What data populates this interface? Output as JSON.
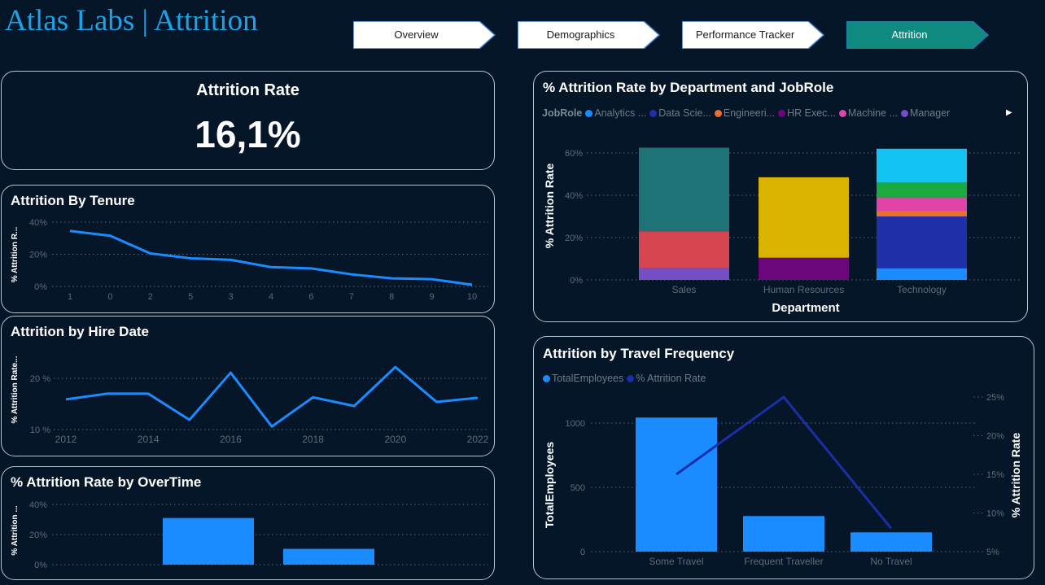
{
  "header": {
    "title": "Atlas Labs | Attrition"
  },
  "nav": [
    {
      "label": "Overview",
      "active": false
    },
    {
      "label": "Demographics",
      "active": false
    },
    {
      "label": "Performance Tracker",
      "active": false
    },
    {
      "label": "Attrition",
      "active": true
    }
  ],
  "colors": {
    "background": "#051629",
    "nav_active": "#0e8a7e",
    "nav_inactive": "#ffffff",
    "line_blue": "#1a8cff",
    "line_navy": "#1b2ea6",
    "gridline": "#5a6672",
    "axis_text": "#5f6b77"
  },
  "kpi": {
    "label": "Attrition Rate",
    "value": "16,1%"
  },
  "chart_data": [
    {
      "id": "tenure",
      "type": "line",
      "title": "Attrition By Tenure",
      "ylabel": "% Attrition R...",
      "xlabel": "",
      "categories": [
        "1",
        "0",
        "2",
        "5",
        "3",
        "4",
        "6",
        "7",
        "8",
        "9",
        "10"
      ],
      "values": [
        34.5,
        31.5,
        20.5,
        17.5,
        16.5,
        12,
        11.2,
        7.5,
        5,
        4.5,
        1
      ],
      "yticks": [
        "40%",
        "20%",
        "0%"
      ],
      "ylim": [
        0,
        40
      ],
      "color": "#1a8cff",
      "grid": true
    },
    {
      "id": "hiredate",
      "type": "line",
      "title": "Attrition by Hire Date",
      "ylabel": "% Attrition Rate...",
      "xlabel": "",
      "x": [
        2012,
        2013,
        2014,
        2015,
        2016,
        2017,
        2018,
        2019,
        2020,
        2021,
        2022
      ],
      "values": [
        15.9,
        17,
        17,
        11.9,
        21.1,
        10.6,
        16.3,
        14.6,
        22.2,
        15.4,
        16.2
      ],
      "xticks": [
        "2012",
        "2014",
        "2016",
        "2018",
        "2020",
        "2022"
      ],
      "yticks": [
        "20 %",
        "10 %"
      ],
      "ylim": [
        10,
        20
      ],
      "color": "#1a8cff",
      "grid": true
    },
    {
      "id": "overtime",
      "type": "bar",
      "title": "% Attrition Rate by OverTime",
      "ylabel": "% Attrition ...",
      "xlabel": "",
      "categories": [
        "",
        ""
      ],
      "values": [
        31,
        10.5
      ],
      "yticks": [
        "40%",
        "20%",
        "0%"
      ],
      "ylim": [
        0,
        40
      ],
      "color": "#1a8cff",
      "grid": true
    },
    {
      "id": "department",
      "type": "bar",
      "stacked": true,
      "title": "% Attrition Rate by Department and JobRole",
      "ylabel": "% Attrition Rate",
      "xlabel": "Department",
      "legend_title": "JobRole",
      "legend": [
        {
          "name": "Analytics ...",
          "color": "#1a8cff"
        },
        {
          "name": "Data Scie...",
          "color": "#1f2fa8"
        },
        {
          "name": "Engineeri...",
          "color": "#e8702a"
        },
        {
          "name": "HR Exec...",
          "color": "#6b067b"
        },
        {
          "name": "Machine ...",
          "color": "#e044a7"
        },
        {
          "name": "Manager",
          "color": "#744ec2"
        }
      ],
      "categories": [
        "Sales",
        "Human Resources",
        "Technology"
      ],
      "stacks": [
        [
          {
            "value": 5.5,
            "color": "#744ec2"
          },
          {
            "value": 17.5,
            "color": "#d64550"
          },
          {
            "value": 39.5,
            "color": "#1f7275"
          }
        ],
        [
          {
            "value": 10.5,
            "color": "#6b067b"
          },
          {
            "value": 38,
            "color": "#d9b300"
          }
        ],
        [
          {
            "value": 5.5,
            "color": "#1a8cff"
          },
          {
            "value": 24.5,
            "color": "#1f2fa8"
          },
          {
            "value": 2.5,
            "color": "#e8702a"
          },
          {
            "value": 6.5,
            "color": "#e044a7"
          },
          {
            "value": 7,
            "color": "#1aab40"
          },
          {
            "value": 16,
            "color": "#13c4f2"
          }
        ]
      ],
      "yticks": [
        "60%",
        "40%",
        "20%",
        "0%"
      ],
      "ylim": [
        0,
        60
      ],
      "grid": true,
      "legend_position": "top-left"
    },
    {
      "id": "travel",
      "type": "bar",
      "title": "Attrition by Travel Frequency",
      "ylabel": "TotalEmployees",
      "y2label": "% Attrition Rate",
      "xlabel": "",
      "legend": [
        {
          "name": "TotalEmployees",
          "color": "#1a8cff"
        },
        {
          "name": "% Attrition Rate",
          "color": "#1b2ea6"
        }
      ],
      "categories": [
        "Some Travel",
        "Frequent Traveller",
        "No Travel"
      ],
      "series": [
        {
          "name": "TotalEmployees",
          "type": "bar",
          "values": [
            1043,
            277,
            150
          ]
        },
        {
          "name": "% Attrition Rate",
          "type": "line",
          "values": [
            15,
            25,
            8
          ]
        }
      ],
      "yticks": [
        "1000",
        "500",
        "0"
      ],
      "y2ticks": [
        "25%",
        "20%",
        "15%",
        "10%",
        "5%"
      ],
      "ylim": [
        0,
        1000
      ],
      "y2lim": [
        5,
        25
      ],
      "grid": true,
      "legend_position": "top-left"
    }
  ]
}
